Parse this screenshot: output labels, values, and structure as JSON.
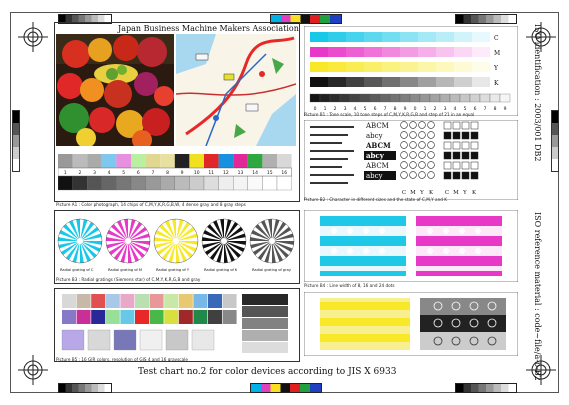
{
  "header": {
    "title": "Japan Business Machine Makers Association"
  },
  "side_texts": {
    "top_right": "ISO identification : 2003/001 DB2",
    "bottom_right": "ISO reference material : code~file/a-b-B2"
  },
  "footer": {
    "title": "Test chart no.2 for color devices according to JIS X 6933"
  },
  "captions": {
    "photo": "Picture A1 : Color photograph, 14 chips of C,M,Y,K,R,G,B,W, 4 dense gray and 8 gray steps",
    "tone_scale": "Picture B1 : Tone scale, 10 tone steps of C,M,Y,K,R,G,B and step of 21 in an equal",
    "character": "Picture B2 : Character in different sizes and the state of C,M,Y and K",
    "radial": "Picture B3 : Radial gratings (Siemens star) of C,M,Y,K,R,G,B and gray",
    "lines": "Picture B4 : Line width of 8, 16 and 24 dots",
    "gray": "Picture B5 : 16 GIR colors, resolution of GIS 4 and 16 grayscale"
  },
  "color_steps": {
    "numbers": [
      "1",
      "2",
      "3",
      "4",
      "5",
      "6",
      "7",
      "8",
      "9",
      "10",
      "11",
      "12",
      "13",
      "14",
      "15",
      "16"
    ]
  },
  "tone_rows": [
    "C",
    "M",
    "Y",
    "K"
  ],
  "tone_numbers": [
    "0",
    "1",
    "2",
    "3",
    "4",
    "5",
    "6",
    "7",
    "8",
    "9",
    "0",
    "1",
    "2",
    "3",
    "4",
    "5",
    "6",
    "7",
    "8",
    "9"
  ],
  "char_rows": [
    {
      "label": "ABCM",
      "bold": false
    },
    {
      "label": "abcy",
      "bold": false
    },
    {
      "label": "ABCM",
      "bold": true
    },
    {
      "label": "abcy",
      "bold": true
    },
    {
      "label": "ABCM",
      "bold": false
    },
    {
      "label": "abcy",
      "bold": false
    }
  ],
  "cmyk_labels": [
    "C",
    "M",
    "Y",
    "K"
  ],
  "star_labels": [
    "Radial grating of C",
    "Radial grating of M",
    "Radial grating of Y",
    "Radial grating of K",
    "Radial grating of gray"
  ],
  "colors": {
    "cyan": "#18c8e8",
    "magenta": "#e838c8",
    "yellow": "#f8e828",
    "black": "#111111"
  }
}
